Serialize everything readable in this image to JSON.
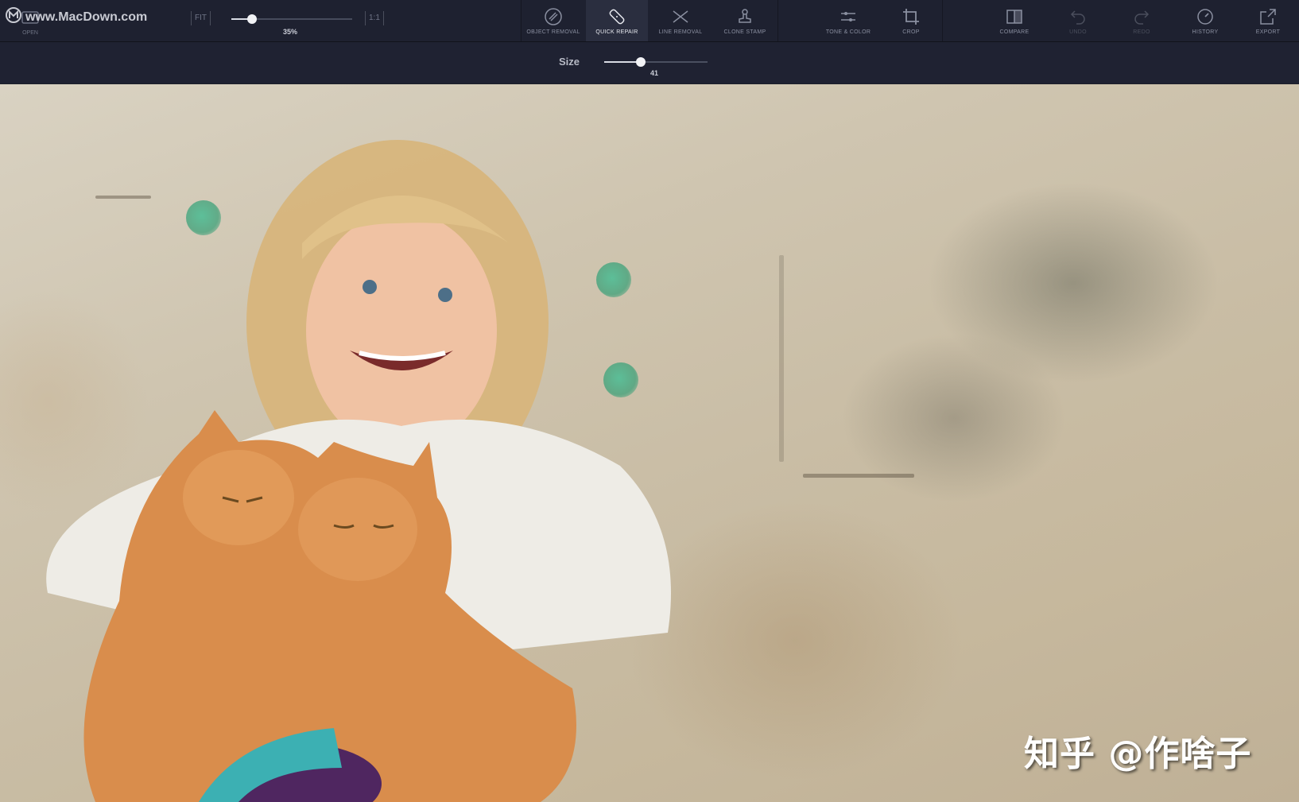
{
  "watermark": {
    "text": "www.MacDown.com"
  },
  "toolbar": {
    "open_label": "OPEN",
    "fit_label": "FIT",
    "one_to_one_label": "1:1",
    "zoom_value": "35%",
    "zoom_fraction": 0.17,
    "tools": [
      {
        "label": "OBJECT REMOVAL",
        "icon": "object-removal-icon",
        "state": "normal"
      },
      {
        "label": "QUICK REPAIR",
        "icon": "bandage-icon",
        "state": "active"
      },
      {
        "label": "LINE REMOVAL",
        "icon": "line-removal-icon",
        "state": "normal"
      },
      {
        "label": "CLONE STAMP",
        "icon": "stamp-icon",
        "state": "normal"
      },
      {
        "label": "TONE & COLOR",
        "icon": "sliders-icon",
        "state": "normal"
      },
      {
        "label": "CROP",
        "icon": "crop-icon",
        "state": "normal"
      },
      {
        "label": "COMPARE",
        "icon": "compare-icon",
        "state": "normal"
      },
      {
        "label": "UNDO",
        "icon": "undo-icon",
        "state": "disabled"
      },
      {
        "label": "REDO",
        "icon": "redo-icon",
        "state": "disabled"
      },
      {
        "label": "HISTORY",
        "icon": "history-icon",
        "state": "normal"
      },
      {
        "label": "EXPORT",
        "icon": "export-icon",
        "state": "normal"
      }
    ]
  },
  "subbar": {
    "size_label": "Size",
    "size_value": "41",
    "size_fraction": 0.35
  },
  "canvas": {
    "repair_marks": 3
  },
  "zh_watermark": "知乎 @作啥子",
  "colors": {
    "toolbar_bg": "#1e2130",
    "repair_mark": "#4fbf96"
  }
}
